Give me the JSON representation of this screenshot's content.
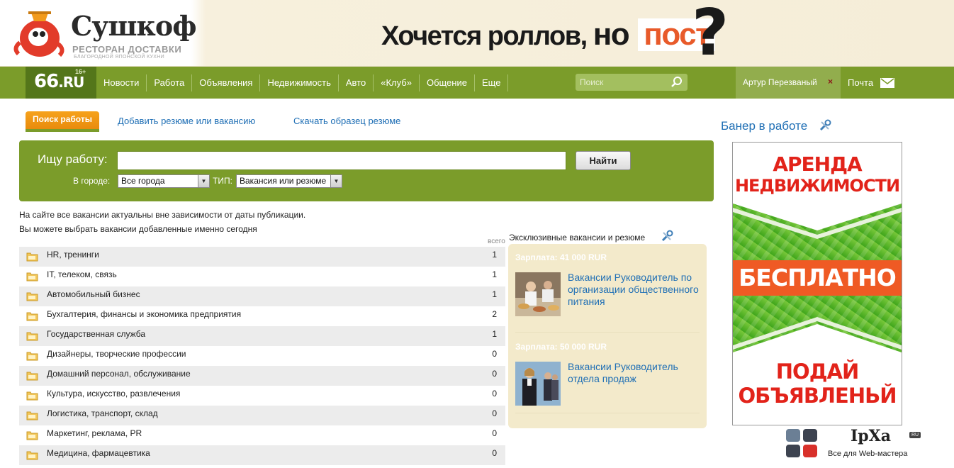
{
  "top_banner": {
    "logo_name": "Сушкоф",
    "logo_tag1": "РЕСТОРАН ДОСТАВКИ",
    "logo_tag2": "БЛАГОРОДНОЙ ЯПОНСКОЙ КУХНИ",
    "slogan_a": "Хочется роллов,",
    "slogan_b": "но",
    "slogan_c": "пост",
    "slogan_q": "?"
  },
  "navbar": {
    "logo": "66",
    "logo_suffix": ".RU",
    "age": "16+",
    "items": [
      {
        "label": "Новости"
      },
      {
        "label": "Работа"
      },
      {
        "label": "Объявления"
      },
      {
        "label": "Недвижимость"
      },
      {
        "label": "Авто"
      },
      {
        "label": "«Клуб»"
      },
      {
        "label": "Общение"
      },
      {
        "label": "Еще"
      }
    ],
    "search_placeholder": "Поиск",
    "user_name": "Артур Перезваный",
    "user_close": "×",
    "mail_label": "Почта"
  },
  "job_tabs": {
    "active": "Поиск работы",
    "add": "Добавить резюме или вакансию",
    "download": "Скачать образец резюме"
  },
  "search": {
    "label": "Ищу работу:",
    "query": "",
    "submit": "Найти",
    "city_label": "В городе:",
    "city_value": "Все города",
    "type_label": "ТИП:",
    "type_value": "Вакансия или резюме"
  },
  "info": {
    "line1": "На сайте все вакансии актуальны вне зависимости от даты публикации.",
    "line2": "Вы можете выбрать вакансии добавленные именно сегодня",
    "total_label": "всего"
  },
  "categories": [
    {
      "name": "HR, тренинги",
      "count": "1"
    },
    {
      "name": "IT, телеком, связь",
      "count": "1"
    },
    {
      "name": "Автомобильный бизнес",
      "count": "1"
    },
    {
      "name": "Бухгалтерия, финансы и экономика предприятия",
      "count": "2"
    },
    {
      "name": "Государственная служба",
      "count": "1"
    },
    {
      "name": "Дизайнеры, творческие профессии",
      "count": "0"
    },
    {
      "name": "Домашний персонал, обслуживание",
      "count": "0"
    },
    {
      "name": "Культура, искусство, развлечения",
      "count": "0"
    },
    {
      "name": "Логистика, транспорт, склад",
      "count": "0"
    },
    {
      "name": "Маркетинг, реклама, PR",
      "count": "0"
    },
    {
      "name": "Медицина, фармацевтика",
      "count": "0"
    }
  ],
  "exclusive": {
    "title": "Эксклюзивные вакансии и резюме",
    "items": [
      {
        "salary": "Зарплата: 41 000 RUR",
        "title": "Вакансии Руководитель по организации общественного питания"
      },
      {
        "salary": "Зарплата: 50 000 RUR",
        "title": "Вакансии Руководитель отдела продаж"
      }
    ]
  },
  "side_banner": {
    "title": "Банер в работе",
    "text1a": "АРЕНДА",
    "text1b": "НЕДВИЖИМОСТИ",
    "text2": "БЕСПЛАТНО",
    "text3a": "ПОДАЙ",
    "text3b": "ОБЪЯВЛЕНЬЙ"
  },
  "watermark": {
    "name": "IpXa",
    "ru": "RU",
    "sub": "Все для Web-мастера"
  },
  "colors": {
    "nav_green": "#7b9c2a",
    "link_blue": "#1f6fb5",
    "tab_orange": "#f6a21c",
    "ad_red": "#e2231a"
  }
}
